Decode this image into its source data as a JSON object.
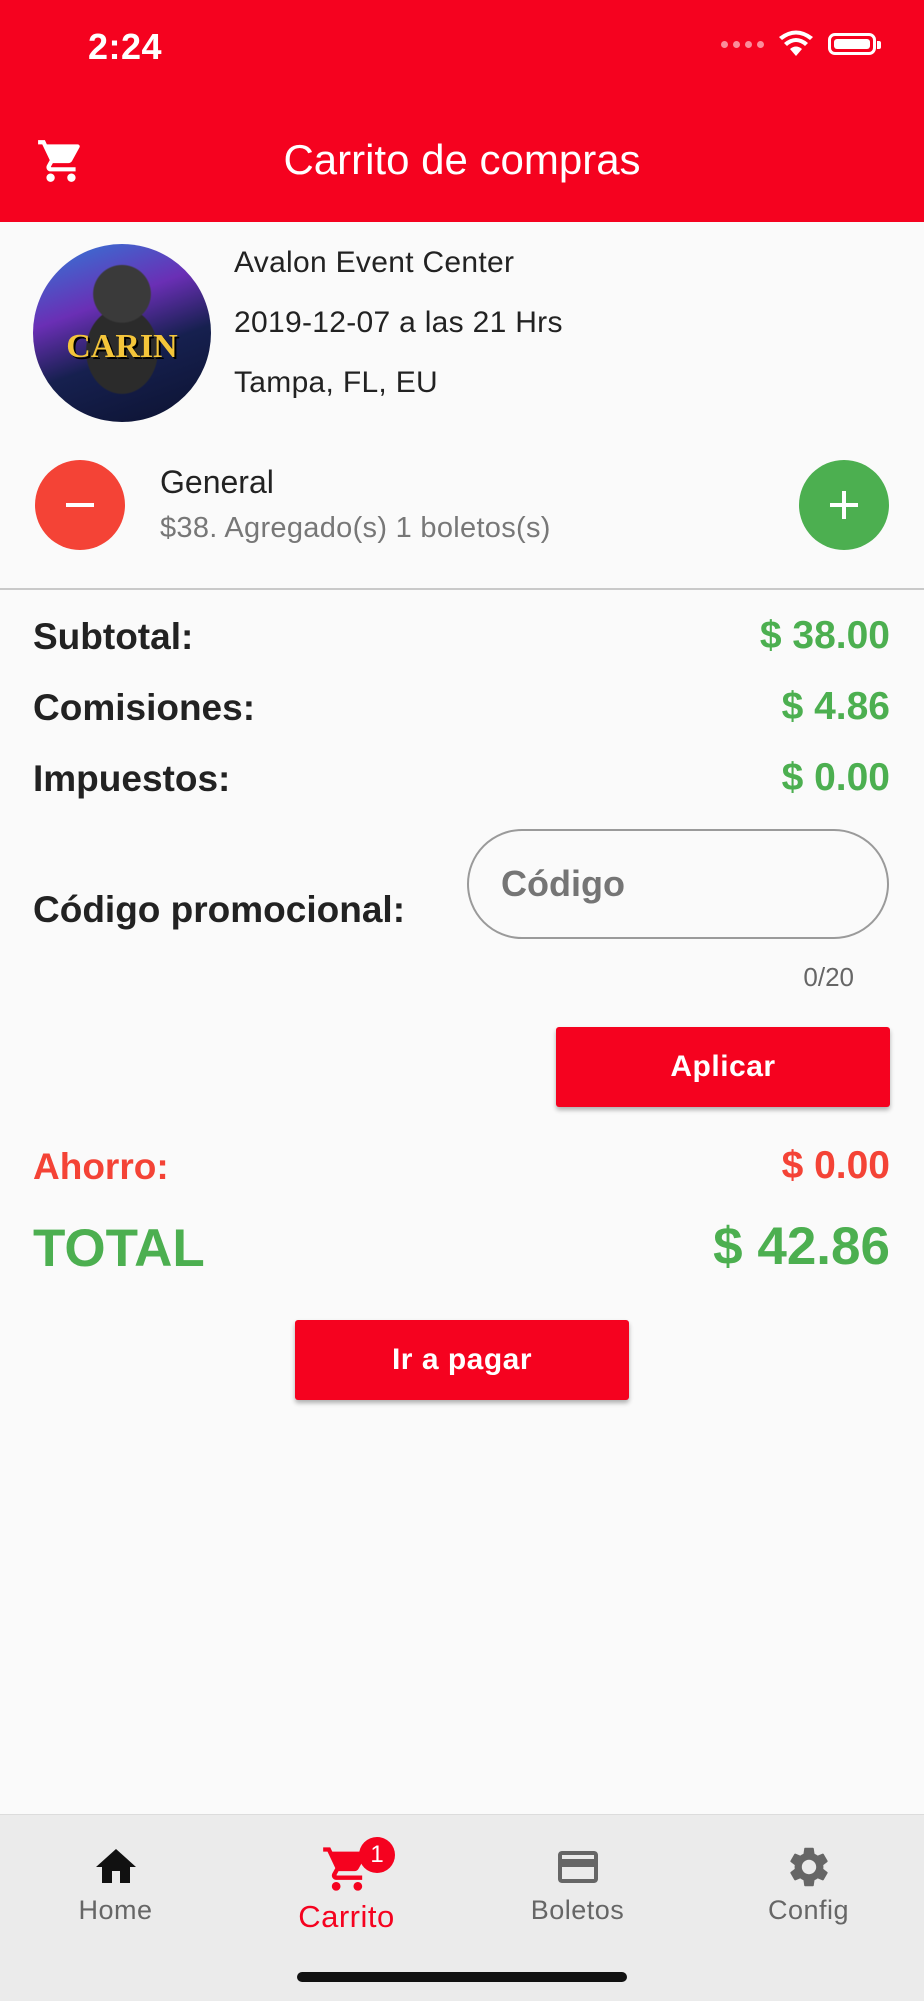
{
  "status_bar": {
    "time": "2:24"
  },
  "header": {
    "title": "Carrito de compras",
    "icon": "cart-icon"
  },
  "event": {
    "venue": "Avalon Event Center",
    "date": "2019-12-07 a las 21 Hrs",
    "location": "Tampa, FL, EU",
    "image_text": "CARIN"
  },
  "ticket": {
    "name": "General",
    "description": "$38. Agregado(s) 1 boletos(s)"
  },
  "summary": {
    "subtotal_label": "Subtotal:",
    "subtotal_value": "$ 38.00",
    "commission_label": "Comisiones:",
    "commission_value": "$ 4.86",
    "tax_label": "Impuestos:",
    "tax_value": "$ 0.00"
  },
  "promo": {
    "label": "Código promocional:",
    "placeholder": "Código",
    "value": "",
    "counter": "0/20",
    "apply_label": "Aplicar"
  },
  "savings": {
    "label": "Ahorro:",
    "value": "$ 0.00"
  },
  "total": {
    "label": "TOTAL",
    "value": "$ 42.86"
  },
  "pay_label": "Ir a pagar",
  "nav": {
    "items": [
      {
        "label": "Home",
        "icon": "home-icon"
      },
      {
        "label": "Carrito",
        "icon": "cart-icon",
        "badge": "1"
      },
      {
        "label": "Boletos",
        "icon": "card-icon"
      },
      {
        "label": "Config",
        "icon": "gear-icon"
      }
    ]
  },
  "colors": {
    "primary": "#f5021f",
    "green": "#4caf50",
    "red": "#f44336",
    "background": "#fafafa"
  }
}
